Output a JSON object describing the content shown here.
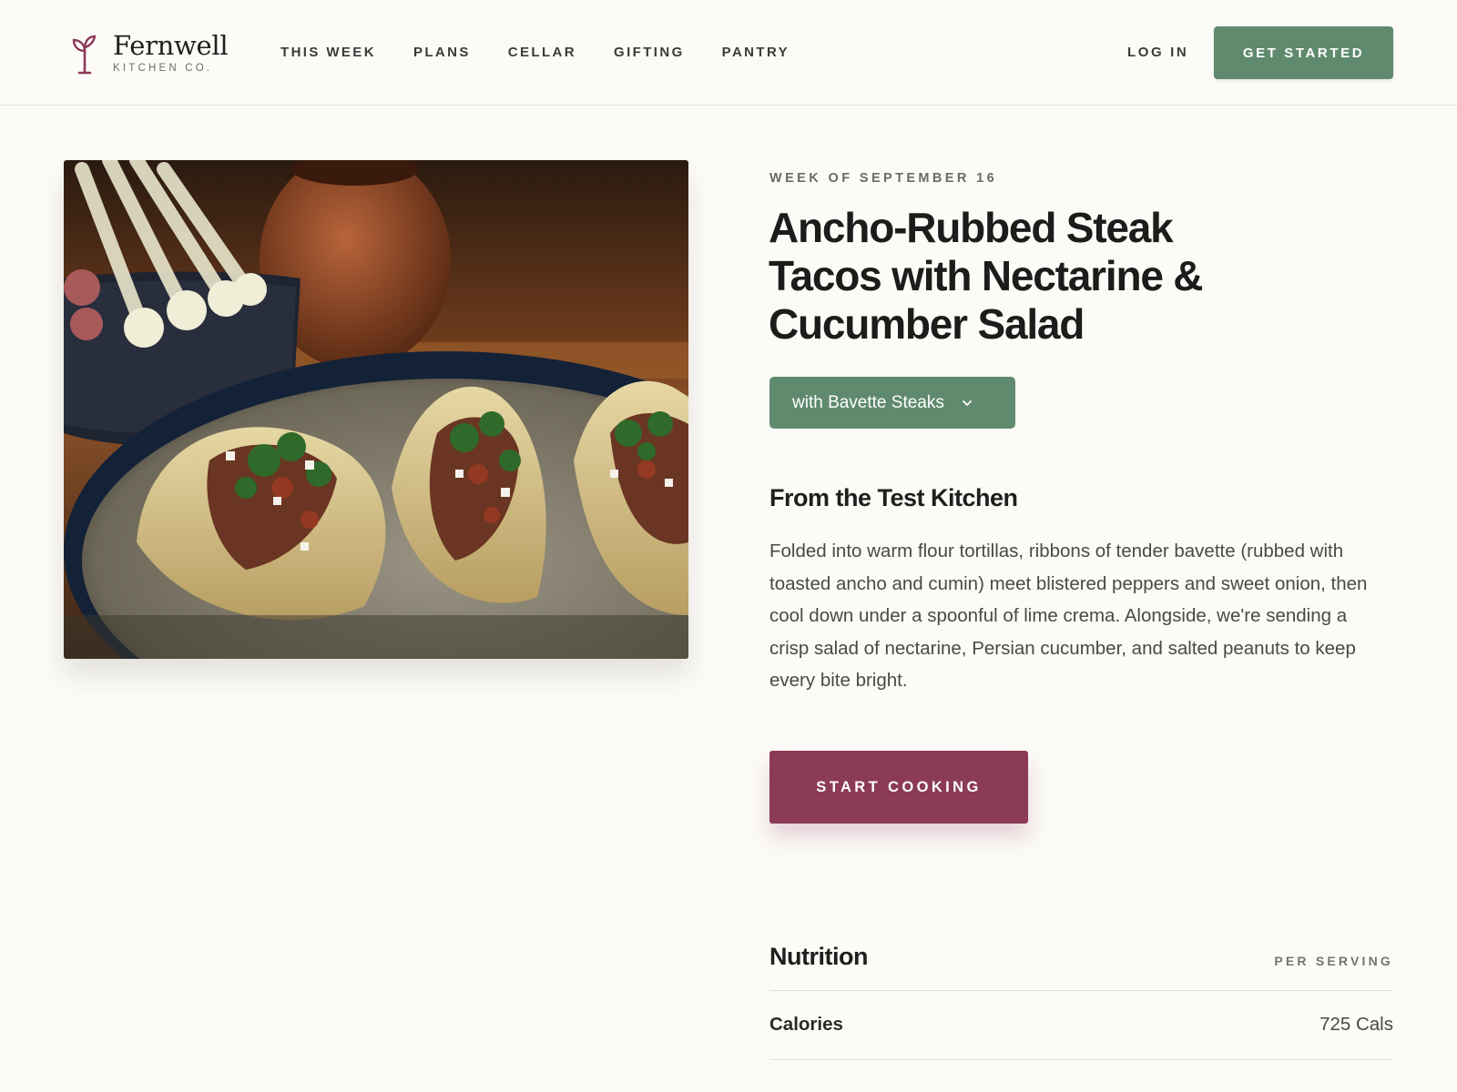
{
  "brand": {
    "name": "Fernwell",
    "subtitle": "KITCHEN CO.",
    "accent": "#8b3a57"
  },
  "nav": {
    "items": [
      "THIS WEEK",
      "PLANS",
      "CELLAR",
      "GIFTING",
      "PANTRY"
    ],
    "login": "LOG IN",
    "cta": "GET STARTED",
    "cta_color": "#5f8a6e"
  },
  "recipe": {
    "week": "WEEK OF SEPTEMBER 16",
    "title": "Ancho-Rubbed Steak Tacos with Nectarine & Cucumber Salad",
    "variant": "with Bavette Steaks",
    "variant_icon": "chevron-down-icon",
    "section_title": "From the Test Kitchen",
    "description": "Folded into warm flour tortillas, ribbons of tender bavette (rubbed with toasted ancho and cumin) meet blistered peppers and sweet onion, then cool down under a spoonful of lime crema. Alongside, we're sending a crisp salad of nectarine, Persian cucumber, and salted peanuts to keep every bite bright.",
    "start_button": "START COOKING"
  },
  "nutrition": {
    "title": "Nutrition",
    "unit_label": "PER SERVING",
    "rows": [
      {
        "label": "Calories",
        "value": "725 Cals"
      }
    ]
  }
}
